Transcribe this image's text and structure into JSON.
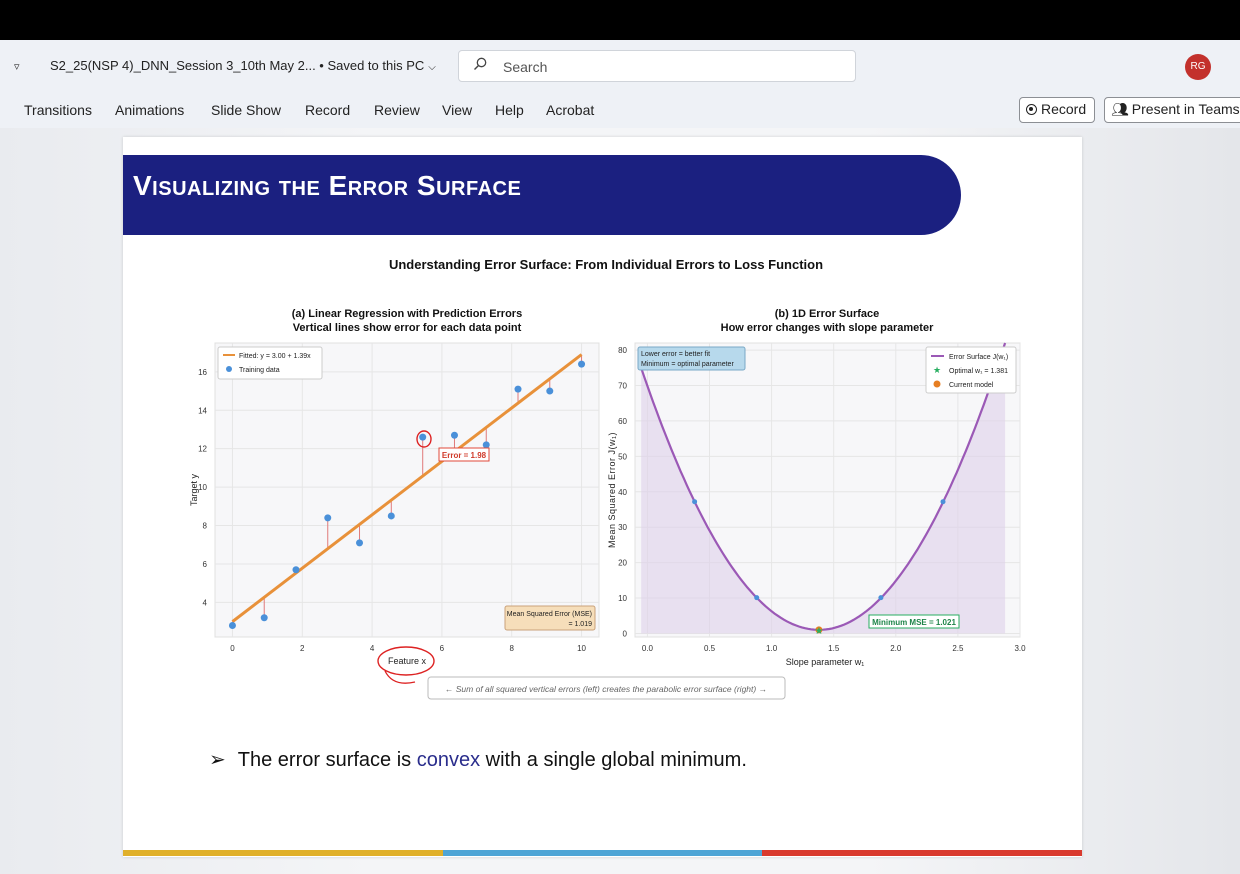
{
  "titlebar": {
    "doc_title": "S2_25(NSP 4)_DNN_Session 3_10th May 2... • Saved to this PC",
    "search_placeholder": "Search",
    "avatar_initials": "RG"
  },
  "ribbon": {
    "tabs": [
      "Transitions",
      "Animations",
      "Slide Show",
      "Record",
      "Review",
      "View",
      "Help",
      "Acrobat"
    ],
    "record_button": "Record",
    "present_button": "Present in Teams"
  },
  "slide": {
    "title": "Visualizing the Error Surface",
    "figure_title": "Understanding Error Surface: From Individual Errors to Loss Function",
    "caption": "← Sum of all squared vertical errors (left) creates the parabolic error surface (right) →",
    "bullet_prefix": "The error surface is ",
    "bullet_highlight": "convex",
    "bullet_suffix": " with a single global minimum.",
    "bar_colors": [
      "#e0b02a",
      "#4ea5d6",
      "#d93a2e"
    ]
  },
  "chart_data": [
    {
      "type": "scatter",
      "title": "(a) Linear Regression with Prediction Errors",
      "subtitle": "Vertical lines show error for each data point",
      "xlabel": "Feature x",
      "ylabel": "Target y",
      "xlim": [
        -0.5,
        10.5
      ],
      "ylim": [
        2.2,
        17.5
      ],
      "xticks": [
        0,
        2,
        4,
        6,
        8,
        10
      ],
      "yticks": [
        4,
        6,
        8,
        10,
        12,
        14,
        16
      ],
      "grid": true,
      "legend": "top-left",
      "series": [
        {
          "name": "Fitted: y = 3.00 + 1.39x",
          "kind": "line",
          "color": "#e8913a",
          "x": [
            0,
            10
          ],
          "y": [
            3.0,
            16.9
          ]
        },
        {
          "name": "Training data",
          "kind": "points",
          "color": "#4a90d9",
          "x": [
            0.0,
            0.91,
            1.82,
            2.73,
            3.64,
            4.55,
            5.45,
            6.36,
            7.27,
            8.18,
            9.09,
            10.0
          ],
          "y": [
            2.8,
            3.2,
            5.7,
            8.4,
            7.1,
            8.5,
            12.6,
            12.7,
            12.2,
            15.1,
            15.0,
            16.4
          ]
        }
      ],
      "annotations": {
        "error_label": "Error = 1.98",
        "mse_label_line1": "Mean Squared Error (MSE)",
        "mse_label_line2": "= 1.019"
      }
    },
    {
      "type": "line",
      "title": "(b) 1D Error Surface",
      "subtitle": "How error changes with slope parameter",
      "xlabel": "Slope parameter w₁",
      "ylabel": "Mean Squared Error J(w₁)",
      "xlim": [
        -0.1,
        3.0
      ],
      "ylim": [
        -1,
        82
      ],
      "xticks": [
        "0.0",
        "0.5",
        "1.0",
        "1.5",
        "2.0",
        "2.5",
        "3.0"
      ],
      "yticks": [
        0,
        10,
        20,
        30,
        40,
        50,
        60,
        70,
        80
      ],
      "grid": true,
      "legend": "top-right",
      "series": [
        {
          "name": "Error Surface J(w₁)",
          "kind": "curve",
          "color": "#9b59b6",
          "formula": "1.021 + 36.1*(w-1.381)^2",
          "x_range": [
            -0.05,
            2.88
          ]
        },
        {
          "name": "Optimal w₁ = 1.381",
          "kind": "star",
          "color": "#27ae60",
          "x": [
            1.381
          ],
          "y": [
            1.021
          ]
        },
        {
          "name": "Current model",
          "kind": "point",
          "color": "#e67e22",
          "x": [
            1.381
          ],
          "y": [
            1.021
          ]
        },
        {
          "name": "sample points",
          "kind": "points",
          "color": "#4a90d9",
          "x": [
            0.38,
            0.88,
            1.88,
            2.38
          ],
          "y": [
            37.2,
            10.1,
            10.1,
            37.2
          ]
        }
      ],
      "annotations": {
        "box_line1": "Lower error = better fit",
        "box_line2": "Minimum = optimal parameter",
        "min_label": "Minimum MSE = 1.021"
      }
    }
  ]
}
